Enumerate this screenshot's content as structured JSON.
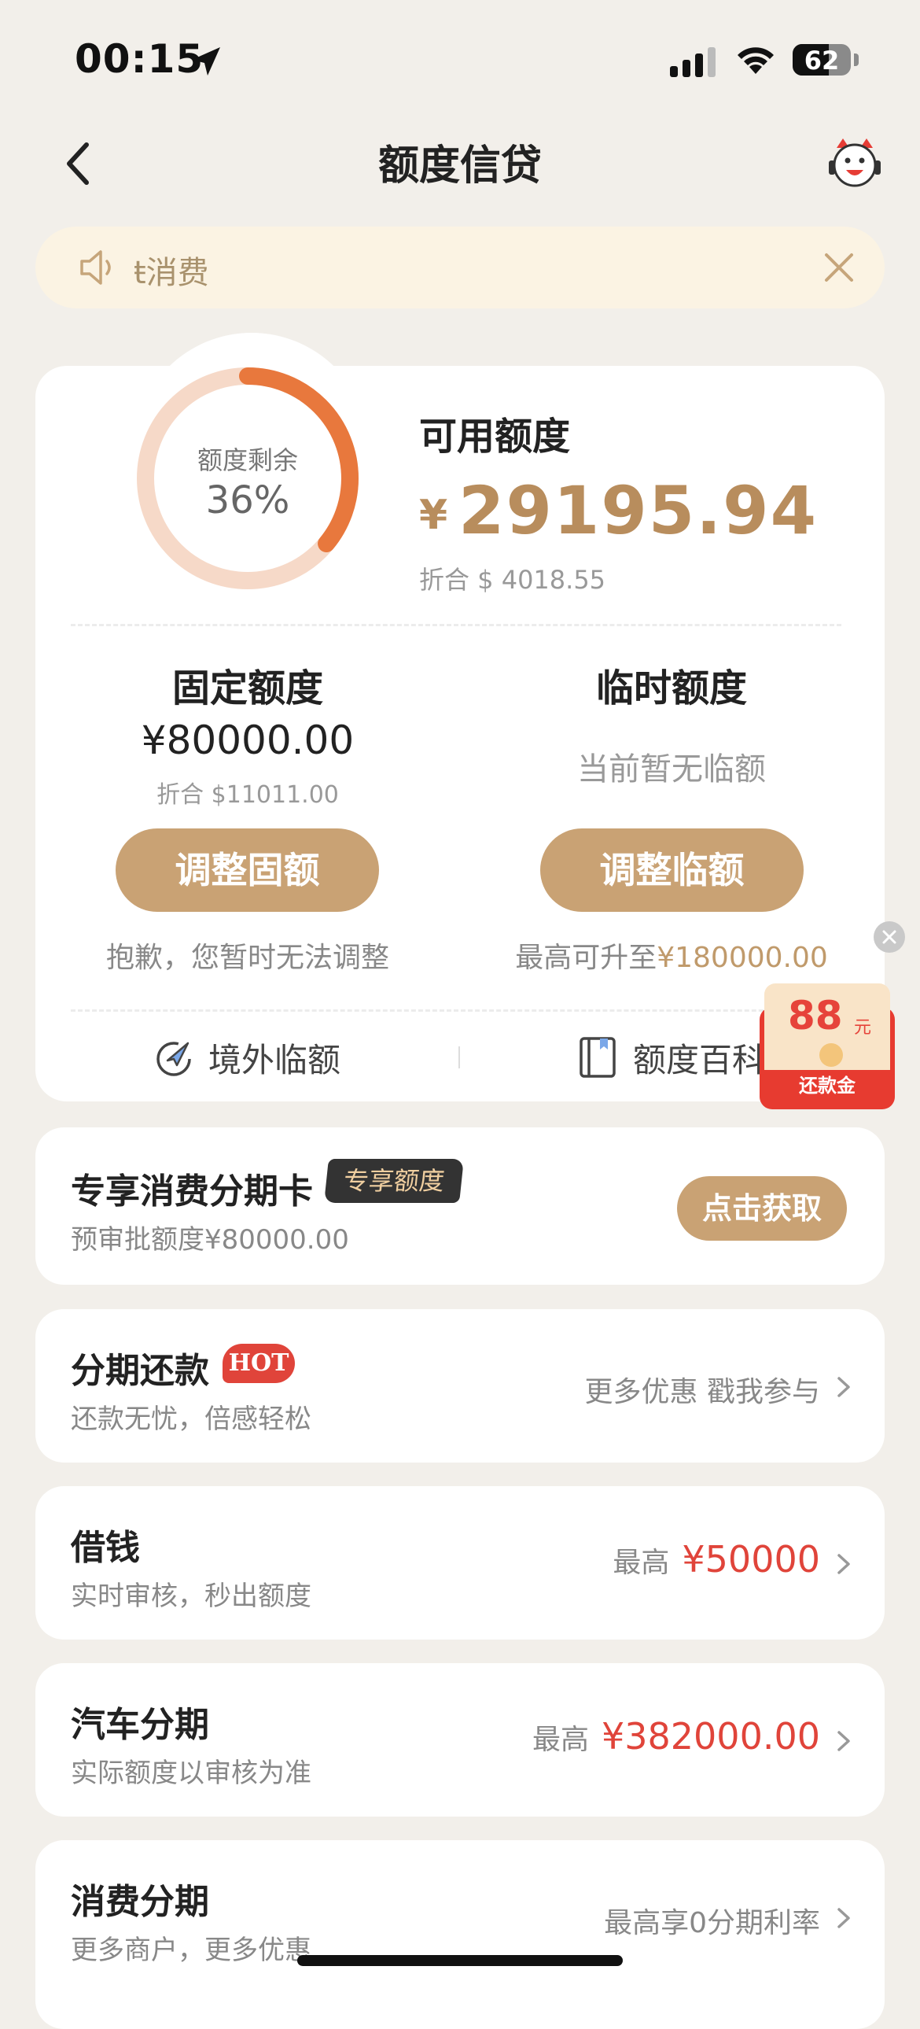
{
  "status_bar": {
    "time": "00:15",
    "battery": "62",
    "battery_level": 0.62
  },
  "header": {
    "title": "额度信贷"
  },
  "notice": {
    "text": "ŧ消费"
  },
  "credit": {
    "ring_label": "额度剩余",
    "ring_percent": "36%",
    "ring_fraction": 0.36,
    "available_label": "可用额度",
    "currency_symbol": "¥",
    "available_amount": "29195.94",
    "available_usd": "折合 $ 4018.55",
    "fixed": {
      "title": "固定额度",
      "amount": "¥80000.00",
      "usd": "折合 $11011.00",
      "button": "调整固额",
      "note": "抱歉，您暂时无法调整"
    },
    "temporary": {
      "title": "临时额度",
      "status": "当前暂无临额",
      "button": "调整临额",
      "note_prefix": "最高可升至",
      "note_amount": "¥180000.00"
    },
    "links": {
      "overseas": "境外临额",
      "wiki": "额度百科"
    }
  },
  "red_packet": {
    "amount": "88",
    "unit": "元",
    "label": "还款金"
  },
  "installment_card": {
    "title": "专享消费分期卡",
    "badge": "专享额度",
    "subtitle": "预审批额度¥80000.00",
    "button": "点击获取"
  },
  "services": [
    {
      "title": "分期还款",
      "badge": "HOT",
      "subtitle": "还款无忧，倍感轻松",
      "right_text": "更多优惠 戳我参与"
    },
    {
      "title": "借钱",
      "subtitle": "实时审核，秒出额度",
      "right_prefix": "最高",
      "right_value": "¥50000"
    },
    {
      "title": "汽车分期",
      "subtitle": "实际额度以审核为准",
      "right_prefix": "最高",
      "right_value": "¥382000.00"
    },
    {
      "title": "消费分期",
      "subtitle": "更多商户，更多优惠",
      "right_text": "最高享0分期利率"
    }
  ],
  "colors": {
    "accent": "#c9a274",
    "amount": "#b88d5d",
    "ring_track": "#f6d9c8",
    "ring_fill": "#e8783d",
    "red": "#e0443a"
  }
}
